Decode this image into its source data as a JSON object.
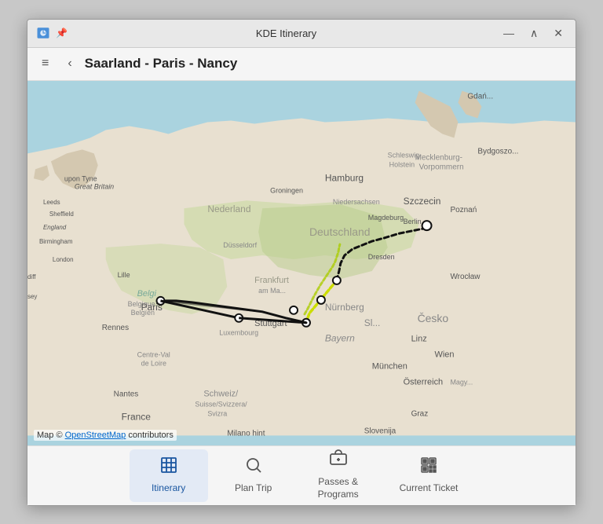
{
  "window": {
    "title": "KDE Itinerary",
    "pin_icon": "📌",
    "controls": {
      "minimize": "—",
      "maximize": "∧",
      "close": "✕"
    }
  },
  "toolbar": {
    "menu_icon": "≡",
    "back_icon": "‹",
    "title": "Saarland - Paris - Nancy"
  },
  "map": {
    "attribution_text": "Map © ",
    "attribution_link": "OpenStreetMap",
    "attribution_suffix": " contributors"
  },
  "bottom_nav": {
    "items": [
      {
        "id": "itinerary",
        "label": "Itinerary",
        "icon": "grid",
        "active": true
      },
      {
        "id": "plan-trip",
        "label": "Plan Trip",
        "icon": "search",
        "active": false
      },
      {
        "id": "passes-programs",
        "label": "Passes &\nPrograms",
        "icon": "card",
        "active": false
      },
      {
        "id": "current-ticket",
        "label": "Current Ticket",
        "icon": "qr",
        "active": false
      }
    ]
  }
}
